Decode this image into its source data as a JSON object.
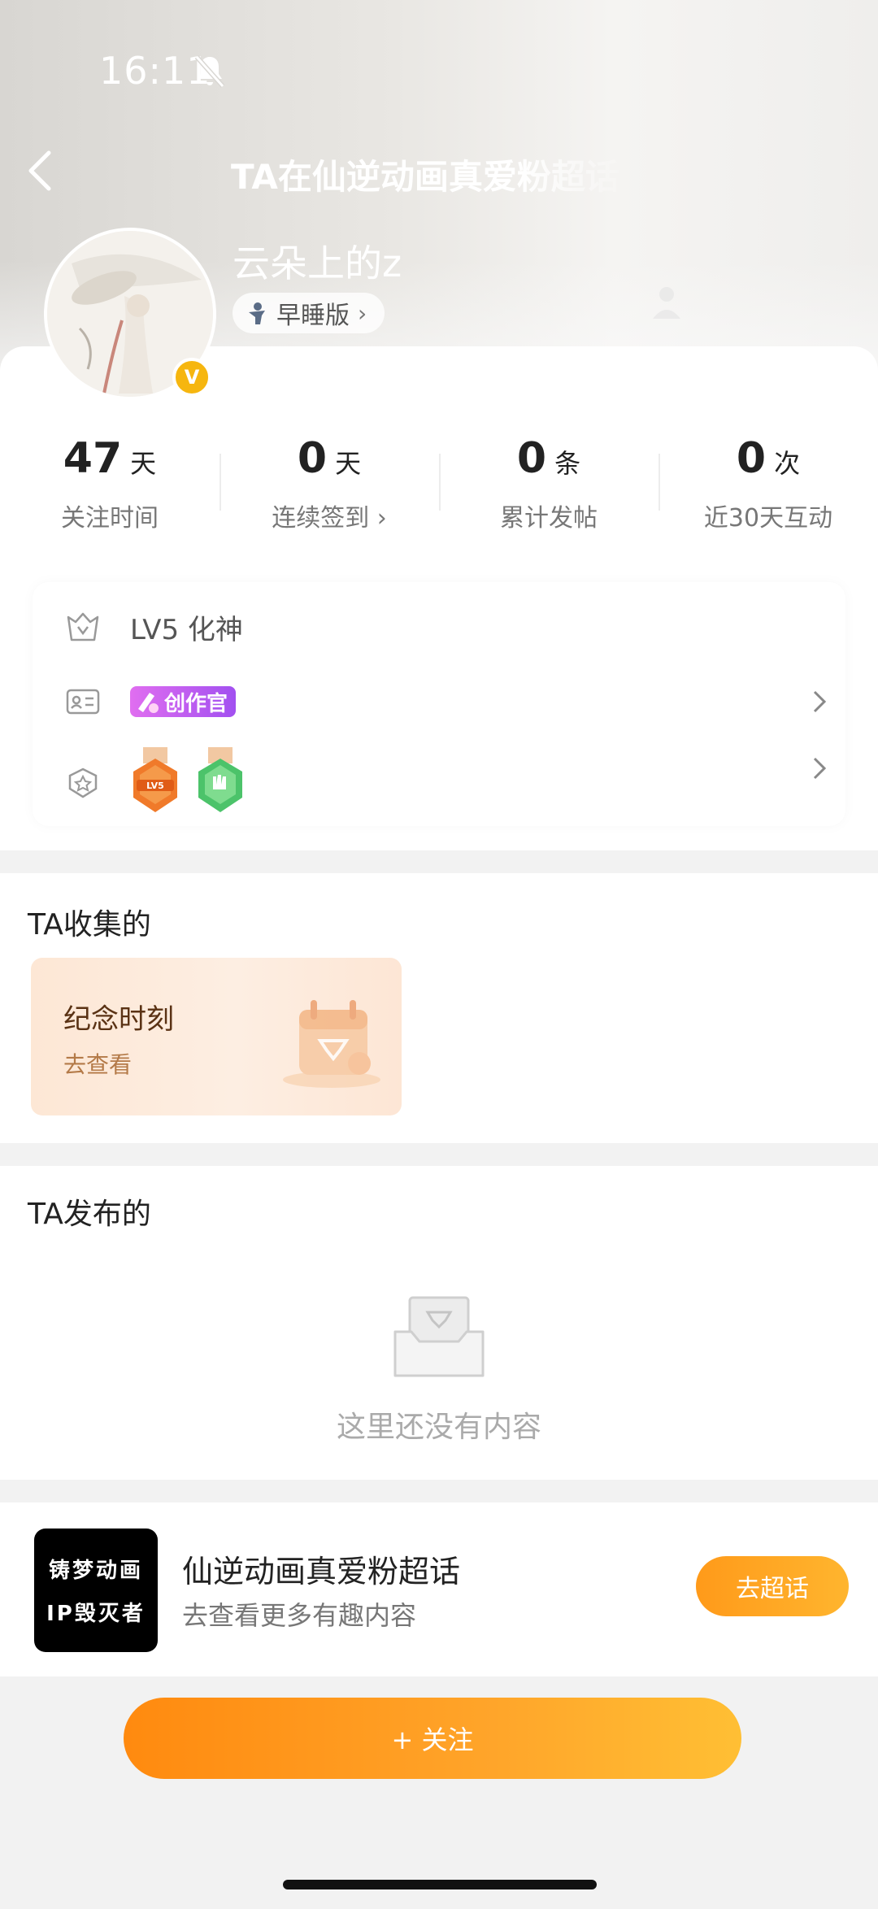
{
  "status_bar": {
    "time": "16:11"
  },
  "header": {
    "title": "TA在仙逆动画真爱粉超话",
    "username": "云朵上的z",
    "tag_label": "早睡版"
  },
  "stats": [
    {
      "value": "47",
      "unit": "天",
      "label": "关注时间"
    },
    {
      "value": "0",
      "unit": "天",
      "label": "连续签到 ›"
    },
    {
      "value": "0",
      "unit": "条",
      "label": "累计发帖"
    },
    {
      "value": "0",
      "unit": "次",
      "label": "近30天互动"
    }
  ],
  "info": {
    "level_text": "LV5 化神",
    "creator_badge": "创作官",
    "medal_lv_text": "LV5"
  },
  "collected": {
    "title": "TA收集的",
    "card_title": "纪念时刻",
    "card_sub": "去查看"
  },
  "published": {
    "title": "TA发布的",
    "empty_text": "这里还没有内容"
  },
  "topic": {
    "logo_line1": "铸梦动画",
    "logo_line2": "IP毁灭者",
    "name": "仙逆动画真爱粉超话",
    "sub": "去查看更多有趣内容",
    "button": "去超话"
  },
  "follow": {
    "label": "+ 关注"
  },
  "colors": {
    "accent": "#ff9a1a",
    "badge": "#f6b60f",
    "creator": "#a250f0"
  }
}
